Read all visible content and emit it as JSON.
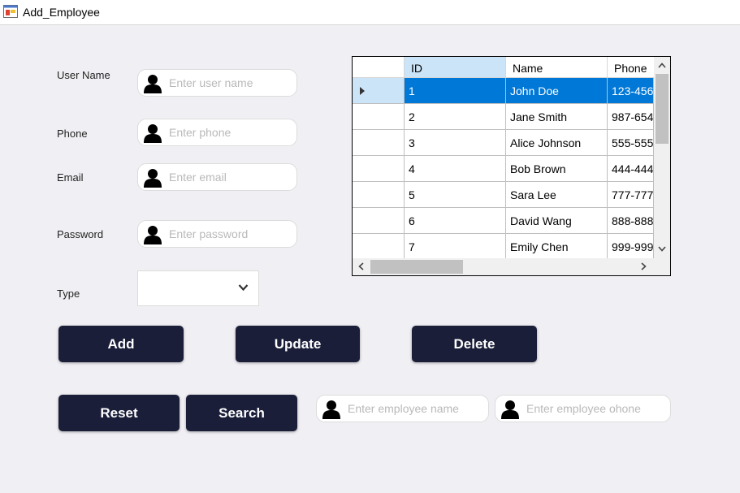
{
  "window": {
    "title": "Add_Employee"
  },
  "form": {
    "username_label": "User Name",
    "username_placeholder": "Enter user name",
    "phone_label": "Phone",
    "phone_placeholder": "Enter phone",
    "email_label": "Email",
    "email_placeholder": "Enter email",
    "password_label": "Password",
    "password_placeholder": "Enter password",
    "type_label": "Type",
    "type_value": ""
  },
  "buttons": {
    "add": "Add",
    "update": "Update",
    "delete": "Delete",
    "reset": "Reset",
    "search": "Search"
  },
  "search": {
    "name_placeholder": "Enter employee name",
    "phone_placeholder": "Enter employee ohone"
  },
  "grid": {
    "columns": [
      "ID",
      "Name",
      "Phone"
    ],
    "rows": [
      [
        "1",
        "John Doe",
        "123-456"
      ],
      [
        "2",
        "Jane Smith",
        "987-654"
      ],
      [
        "3",
        "Alice Johnson",
        "555-555"
      ],
      [
        "4",
        "Bob Brown",
        "444-444"
      ],
      [
        "5",
        "Sara Lee",
        "777-777"
      ],
      [
        "6",
        "David Wang",
        "888-888"
      ],
      [
        "7",
        "Emily Chen",
        "999-999"
      ]
    ],
    "selected_row": 0
  },
  "colors": {
    "button_bg": "#1a1e39",
    "selection": "#0078d7",
    "selected_header": "#cce4f7"
  }
}
